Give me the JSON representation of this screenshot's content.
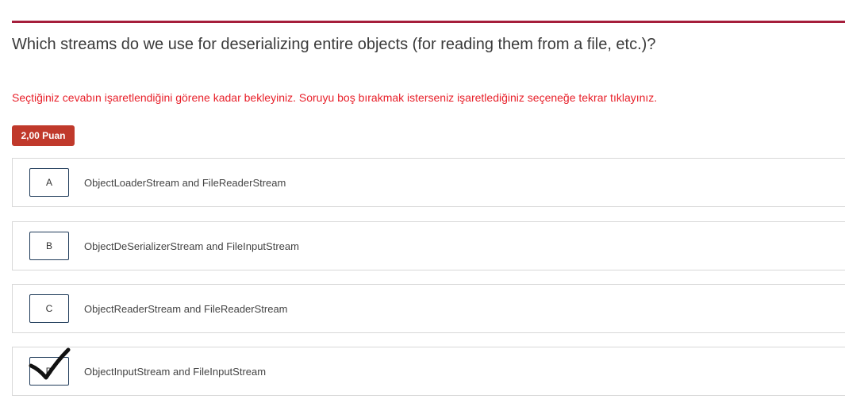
{
  "question": {
    "text": "Which streams do we use for deserializing entire objects (for reading them from a file, etc.)?"
  },
  "instruction": "Seçtiğiniz cevabın işaretlendiğini görene kadar bekleyiniz. Soruyu boş bırakmak isterseniz işaretlediğiniz seçeneğe tekrar tıklayınız.",
  "points_badge": "2,00 Puan",
  "options": [
    {
      "letter": "A",
      "text": "ObjectLoaderStream and FileReaderStream",
      "selected": false
    },
    {
      "letter": "B",
      "text": "ObjectDeSerializerStream and FileInputStream",
      "selected": false
    },
    {
      "letter": "C",
      "text": "ObjectReaderStream and FileReaderStream",
      "selected": false
    },
    {
      "letter": "D",
      "text": "ObjectInputStream and FileInputStream",
      "selected": true,
      "marker_icon": "checkmark-icon"
    }
  ],
  "colors": {
    "accent": "#a51e3b",
    "badge": "#c0392b",
    "instruction": "#e8202a",
    "option_border": "#d8d8d8",
    "letter_border": "#1f3b5a"
  }
}
